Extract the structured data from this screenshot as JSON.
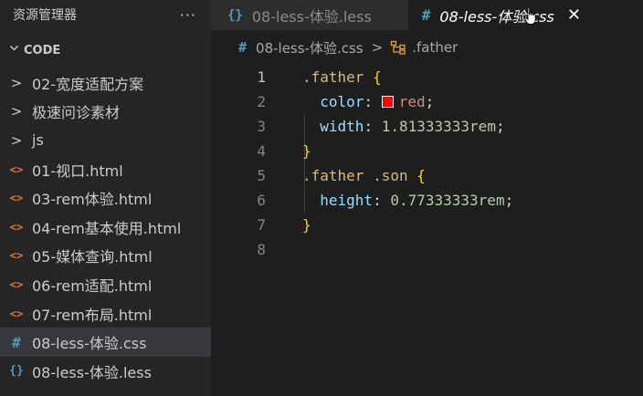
{
  "sidebar": {
    "title": "资源管理器",
    "more_label": "···",
    "section": "CODE",
    "items": [
      {
        "label": "02-宽度适配方案",
        "type": "folder",
        "icon": ">"
      },
      {
        "label": "极速问诊素材",
        "type": "folder",
        "icon": ">"
      },
      {
        "label": "js",
        "type": "folder",
        "icon": ">"
      },
      {
        "label": "01-视口.html",
        "type": "html",
        "icon": "<>"
      },
      {
        "label": "03-rem体验.html",
        "type": "html",
        "icon": "<>"
      },
      {
        "label": "04-rem基本使用.html",
        "type": "html",
        "icon": "<>"
      },
      {
        "label": "05-媒体查询.html",
        "type": "html",
        "icon": "<>"
      },
      {
        "label": "06-rem适配.html",
        "type": "html",
        "icon": "<>"
      },
      {
        "label": "07-rem布局.html",
        "type": "html",
        "icon": "<>"
      },
      {
        "label": "08-less-体验.css",
        "type": "css",
        "icon": "#",
        "selected": true
      },
      {
        "label": "08-less-体验.less",
        "type": "less",
        "icon": "{}"
      }
    ]
  },
  "tabs": [
    {
      "label": "08-less-体验.less",
      "icon": "{}",
      "active": false
    },
    {
      "label": "08-less-体验.css",
      "icon": "#",
      "active": true,
      "close": "✕"
    }
  ],
  "breadcrumb": {
    "file_icon": "#",
    "file": "08-less-体验.css",
    "separator": ">",
    "symbol": ".father"
  },
  "editor": {
    "line_numbers": [
      "1",
      "2",
      "3",
      "4",
      "5",
      "6",
      "7",
      "8"
    ],
    "lines": {
      "l1": {
        "selector": ".father",
        "brace": "{"
      },
      "l2": {
        "prop": "color",
        "colon": ":",
        "value": "red",
        "semi": ";"
      },
      "l3": {
        "prop": "width",
        "colon": ":",
        "value": "1.81333333rem",
        "semi": ";"
      },
      "l4": {
        "brace": "}"
      },
      "l5": {
        "selector": ".father .son",
        "brace": "{"
      },
      "l6": {
        "prop": "height",
        "colon": ":",
        "value": "0.77333333rem",
        "semi": ";"
      },
      "l7": {
        "brace": "}"
      }
    },
    "swatch_color": "#ff0000"
  },
  "colors": {
    "editor_bg": "#1e1e1e",
    "sidebar_bg": "#252526",
    "selector": "#d7ba7d",
    "brace": "#ffd700",
    "property": "#9cdcfe",
    "string_value": "#ce9178",
    "number_value": "#b5cea8",
    "file_css": "#519aba",
    "file_html": "#e37933"
  }
}
